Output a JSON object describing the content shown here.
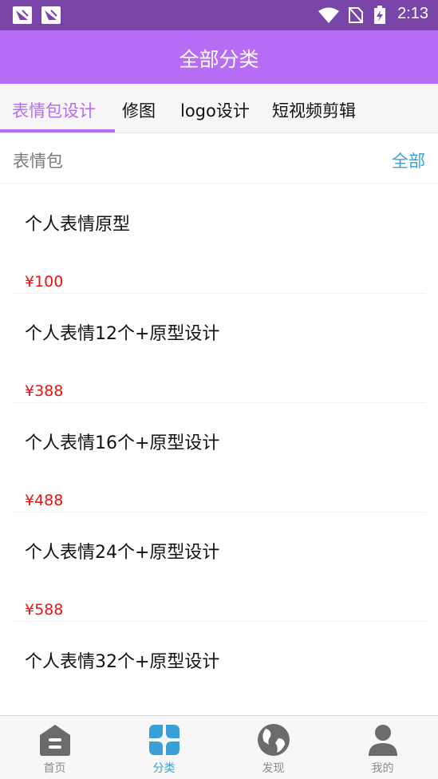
{
  "status_bar": {
    "time": "2:13"
  },
  "app_bar": {
    "title": "全部分类"
  },
  "tabs": [
    {
      "label": "表情包设计",
      "active": true
    },
    {
      "label": "修图",
      "active": false
    },
    {
      "label": "logo设计",
      "active": false
    },
    {
      "label": "短视频剪辑",
      "active": false
    }
  ],
  "section": {
    "name": "表情包",
    "all_label": "全部"
  },
  "items": [
    {
      "title": "个人表情原型",
      "price": "¥100"
    },
    {
      "title": "个人表情12个+原型设计",
      "price": "¥388"
    },
    {
      "title": "个人表情16个+原型设计",
      "price": "¥488"
    },
    {
      "title": "个人表情24个+原型设计",
      "price": "¥588"
    },
    {
      "title": "个人表情32个+原型设计",
      "price": ""
    }
  ],
  "bottom_nav": [
    {
      "label": "首页",
      "icon": "home-icon",
      "active": false
    },
    {
      "label": "分类",
      "icon": "category-icon",
      "active": true
    },
    {
      "label": "发现",
      "icon": "globe-icon",
      "active": false
    },
    {
      "label": "我的",
      "icon": "user-icon",
      "active": false
    }
  ],
  "colors": {
    "accent": "#b66cf5",
    "status_bar": "#7a45a8",
    "link": "#3a9ed8",
    "price": "#ee1111",
    "icon_gray": "#6b6b6b"
  }
}
